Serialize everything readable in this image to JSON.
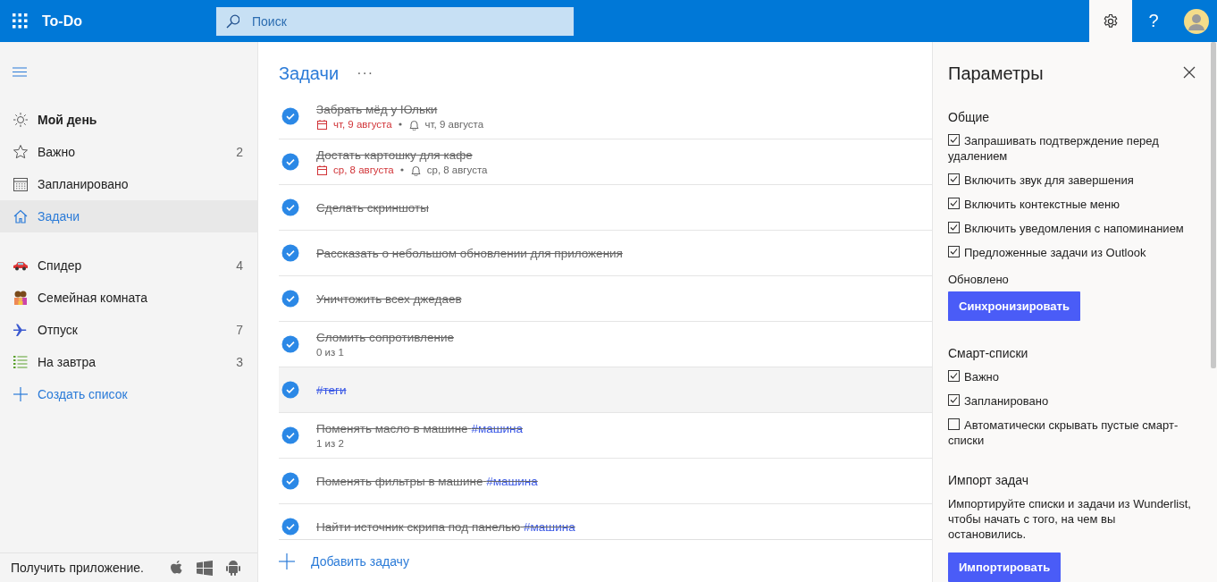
{
  "header": {
    "app_name": "To-Do",
    "search": {
      "placeholder": "Поиск"
    },
    "settings_open": true,
    "help": "?"
  },
  "sidebar": {
    "smart_lists": [
      {
        "label": "Мой день",
        "selected": false
      },
      {
        "label": "Важно",
        "count": "2",
        "selected": false
      },
      {
        "label": "Запланировано",
        "selected": false
      },
      {
        "label": "Задачи",
        "selected": true
      }
    ],
    "lists": [
      {
        "label": "Спидер",
        "count": "4",
        "selected": false
      },
      {
        "label": "Семейная комната",
        "selected": false
      },
      {
        "label": "Отпуск",
        "count": "7",
        "selected": false
      },
      {
        "label": "На завтра",
        "count": "3",
        "selected": false
      }
    ],
    "new_list": "Создать список",
    "footer": "Получить приложение."
  },
  "tasks": {
    "title": "Задачи",
    "more": "···",
    "items": [
      {
        "title": "Забрать мёд у Юльки",
        "completed": true,
        "selected": false,
        "due": "чт, 9 августа",
        "reminder": "чт, 9 августа"
      },
      {
        "title": "Достать картошку для кафе",
        "completed": true,
        "selected": false,
        "due": "ср, 8 августа",
        "reminder": "ср, 8 августа"
      },
      {
        "title": "Сделать скриншоты",
        "completed": true,
        "selected": false
      },
      {
        "title": "Рассказать о небольшом обновлении для приложения",
        "completed": true,
        "selected": false
      },
      {
        "title": "Уничтожить всех джедаев",
        "completed": true,
        "selected": false
      },
      {
        "title": "Сломить сопротивление",
        "completed": true,
        "selected": false,
        "steps": "0 из 1"
      },
      {
        "tag": "#теги",
        "completed": true,
        "selected": true
      },
      {
        "title": "Поменять масло в машине",
        "tag": "#машина",
        "completed": true,
        "selected": false,
        "steps": "1 из 2"
      },
      {
        "title": "Поменять фильтры в машине",
        "tag": "#машина",
        "completed": true,
        "selected": false
      },
      {
        "title": "Найти источник скрипа под панелью",
        "tag": "#машина",
        "completed": true,
        "selected": false
      }
    ],
    "add_task": "Добавить задачу"
  },
  "settings": {
    "title": "Параметры",
    "sections": [
      {
        "heading": "Общие",
        "options": [
          {
            "label": "Запрашивать подтверждение перед удалением",
            "checked": true
          },
          {
            "label": "Включить звук для завершения",
            "checked": true
          },
          {
            "label": "Включить контекстные меню",
            "checked": true
          },
          {
            "label": "Включить уведомления с напоминанием",
            "checked": true
          },
          {
            "label": "Предложенные задачи из Outlook",
            "checked": true
          }
        ],
        "status": "Обновлено",
        "button": "Синхронизировать"
      },
      {
        "heading": "Смарт-списки",
        "options": [
          {
            "label": "Важно",
            "checked": true
          },
          {
            "label": "Запланировано",
            "checked": true
          },
          {
            "label": "Автоматически скрывать пустые смарт-списки",
            "checked": false
          }
        ]
      },
      {
        "heading": "Импорт задач",
        "text": "Импортируйте списки и задачи из Wunderlist, чтобы начать с того, на чем вы остановились.",
        "button": "Импортировать"
      }
    ]
  }
}
